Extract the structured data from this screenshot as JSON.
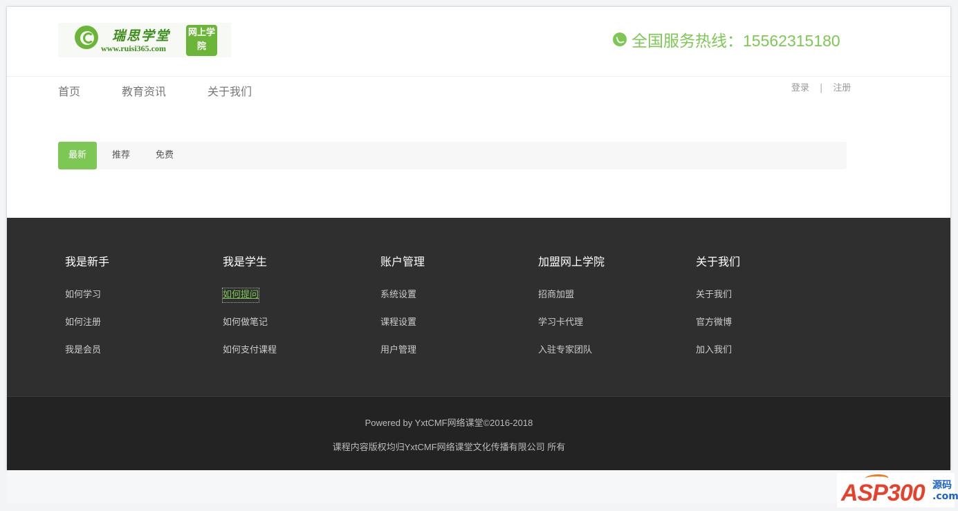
{
  "header": {
    "logo_title": "瑞思学堂",
    "logo_url": "www.ruisi365.com",
    "logo_badge": "网上学院",
    "hotline": "全国服务热线：15562315180"
  },
  "nav": {
    "items": [
      "首页",
      "教育资讯",
      "关于我们"
    ]
  },
  "auth": {
    "login": "登录",
    "separator": "|",
    "register": "注册"
  },
  "tabs": {
    "items": [
      "最新",
      "推荐",
      "免费"
    ],
    "active": "最新"
  },
  "footer": {
    "columns": [
      {
        "title": "我是新手",
        "links": [
          "如何学习",
          "如何注册",
          "我是会员"
        ]
      },
      {
        "title": "我是学生",
        "links": [
          "如何提问",
          "如何做笔记",
          "如何支付课程"
        ]
      },
      {
        "title": "账户管理",
        "links": [
          "系统设置",
          "课程设置",
          "用户管理"
        ]
      },
      {
        "title": "加盟网上学院",
        "links": [
          "招商加盟",
          "学习卡代理",
          "入驻专家团队"
        ]
      },
      {
        "title": "关于我们",
        "links": [
          "关于我们",
          "官方微博",
          "加入我们"
        ]
      }
    ],
    "highlighted_link": "如何提问"
  },
  "copyright": {
    "line1": "Powered by YxtCMF网络课堂©2016-2018",
    "line2": "课程内容版权均归YxtCMF网络课堂文化传播有限公司 所有"
  },
  "watermark": {
    "brand": "ASP300",
    "side_top": "源码",
    "side_bottom": ".com"
  },
  "colors": {
    "accent": "#7dc855",
    "footer_bg": "#2f2f2f",
    "copyright_bg": "#232323"
  }
}
